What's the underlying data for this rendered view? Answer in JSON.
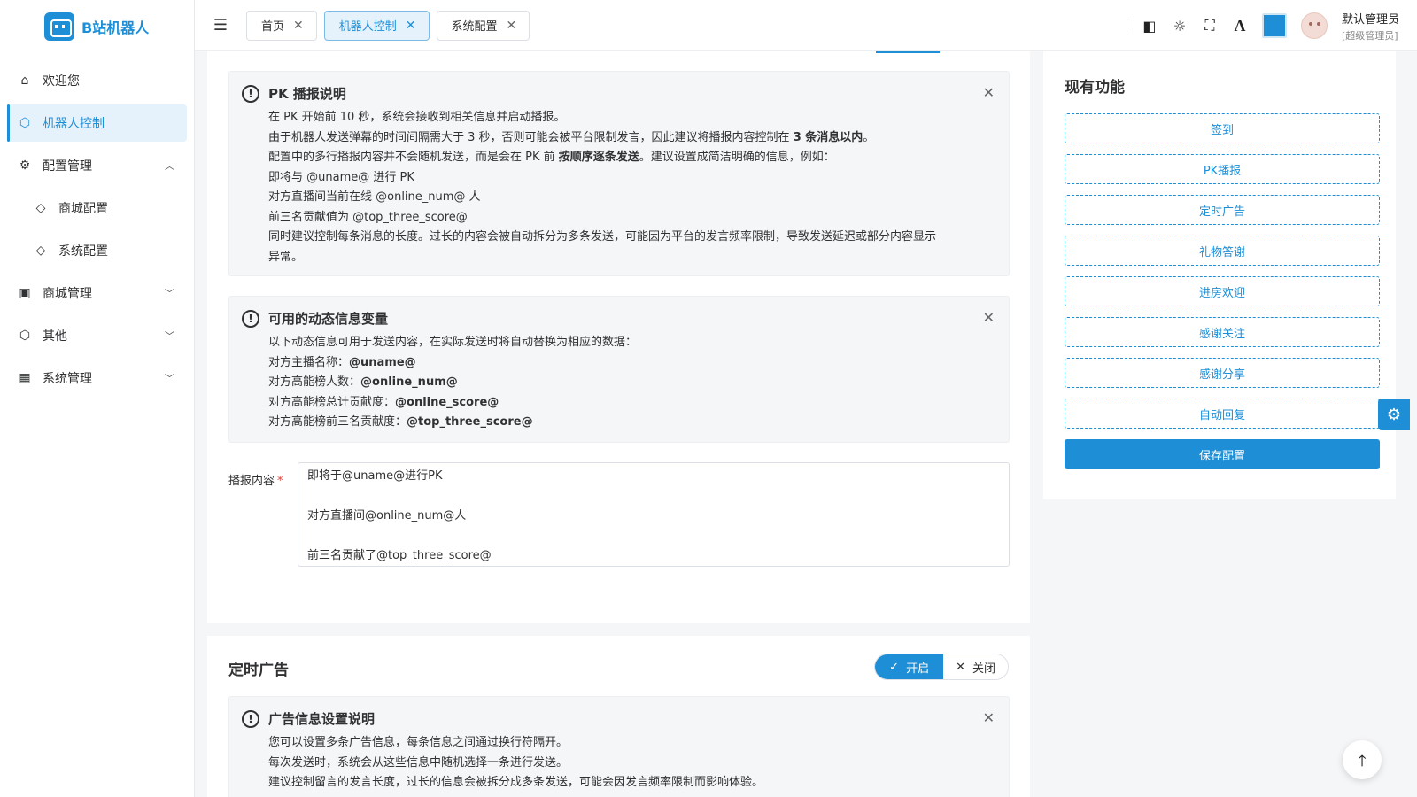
{
  "app": {
    "logo_text": "B站机器人",
    "accent": "#1e8fd6"
  },
  "sidebar": {
    "items": [
      {
        "label": "欢迎您",
        "icon": "home-icon"
      },
      {
        "label": "机器人控制",
        "icon": "cube-icon",
        "active": true
      },
      {
        "label": "配置管理",
        "icon": "gear-icon",
        "expanded": true
      },
      {
        "label": "商城配置",
        "icon": "tag-icon",
        "sub": true
      },
      {
        "label": "系统配置",
        "icon": "tag-icon",
        "sub": true
      },
      {
        "label": "商城管理",
        "icon": "shop-icon"
      },
      {
        "label": "其他",
        "icon": "cube-icon"
      },
      {
        "label": "系统管理",
        "icon": "grid-icon"
      }
    ]
  },
  "header": {
    "tabs": [
      {
        "label": "首页"
      },
      {
        "label": "机器人控制",
        "active": true
      },
      {
        "label": "系统配置"
      }
    ],
    "user_name": "默认管理员",
    "user_role": "[超级管理员]",
    "font_icon_glyph": "A"
  },
  "pk_alert": {
    "title": "PK 播报说明",
    "lines": [
      "在 PK 开始前 10 秒，系统会接收到相关信息并启动播报。",
      "由于机器人发送弹幕的时间间隔需大于 3 秒，否则可能会被平台限制发言，因此建议将播报内容控制在",
      "3 条消息以内",
      "。",
      "配置中的多行播报内容并不会随机发送，而是会在 PK 前",
      "按顺序逐条发送",
      "。建议设置成简洁明确的信息，例如：",
      "即将与 @uname@ 进行 PK",
      "对方直播间当前在线 @online_num@ 人",
      "前三名贡献值为 @top_three_score@",
      "同时建议控制每条消息的长度。过长的内容会被自动拆分为多条发送，可能因为平台的发言频率限制，导致发送延迟或部分内容显示",
      "异常。"
    ]
  },
  "var_alert": {
    "title": "可用的动态信息变量",
    "intro": "以下动态信息可用于发送内容，在实际发送时将自动替换为相应的数据：",
    "vars": [
      {
        "label": "对方主播名称：",
        "value": "@uname@"
      },
      {
        "label": "对方高能榜人数：",
        "value": "@online_num@"
      },
      {
        "label": "对方高能榜总计贡献度：",
        "value": "@online_score@"
      },
      {
        "label": "对方高能榜前三名贡献度：",
        "value": "@top_three_score@"
      }
    ]
  },
  "form": {
    "label": "播报内容",
    "required_mark": "*",
    "value": "即将于@uname@进行PK\n\n对方直播间@online_num@人\n\n前三名贡献了@top_three_score@"
  },
  "ad_section": {
    "title": "定时广告",
    "toggle_on": "开启",
    "toggle_off": "关闭",
    "alert_title": "广告信息设置说明",
    "lines": [
      "您可以设置多条广告信息，每条信息之间通过换行符隔开。",
      "每次发送时，系统会从这些信息中随机选择一条进行发送。",
      "建议控制留言的发言长度，过长的信息会被拆分成多条发送，可能会因发言频率限制而影响体验。"
    ]
  },
  "right_panel": {
    "title": "现有功能",
    "features": [
      "签到",
      "PK播报",
      "定时广告",
      "礼物答谢",
      "进房欢迎",
      "感谢关注",
      "感谢分享",
      "自动回复"
    ],
    "save_label": "保存配置"
  }
}
